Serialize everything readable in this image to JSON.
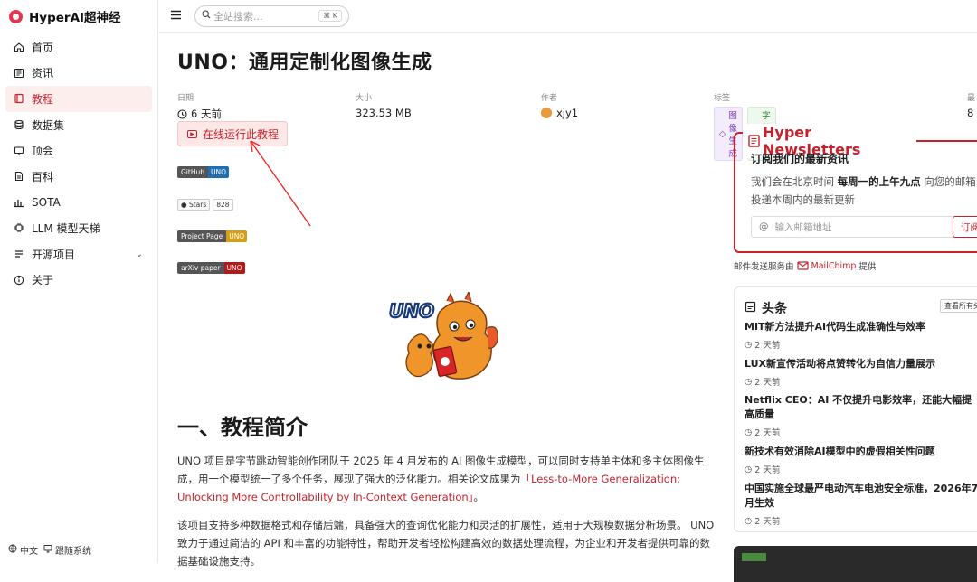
{
  "app": {
    "name": "HyperAI超神经"
  },
  "sidebar": {
    "items": [
      {
        "label": "首页",
        "icon": "home-icon"
      },
      {
        "label": "资讯",
        "icon": "news-icon"
      },
      {
        "label": "教程",
        "icon": "book-icon",
        "active": true
      },
      {
        "label": "数据集",
        "icon": "database-icon"
      },
      {
        "label": "顶会",
        "icon": "conference-icon"
      },
      {
        "label": "百科",
        "icon": "wiki-icon"
      },
      {
        "label": "SOTA",
        "icon": "chart-icon"
      },
      {
        "label": "LLM 模型天梯",
        "icon": "cpu-icon"
      },
      {
        "label": "开源项目",
        "icon": "list-icon",
        "expandable": true
      },
      {
        "label": "关于",
        "icon": "info-icon"
      }
    ],
    "footer": {
      "language": "中文",
      "theme": "跟随系统"
    }
  },
  "topbar": {
    "search_placeholder": "全站搜索...",
    "shortcut": "⌘ K"
  },
  "article": {
    "title": "UNO：通用定制化图像生成",
    "meta": {
      "date_label": "日期",
      "date_value": "6 天前",
      "size_label": "大小",
      "size_value": "323.53 MB",
      "author_label": "作者",
      "author_value": "xjy1",
      "tags_label": "标签",
      "tags": [
        "图像生成",
        "字节跳动"
      ],
      "extra_label": "最",
      "extra_value": "8"
    },
    "run_button": "在线运行此教程",
    "badges": [
      {
        "left": "GitHub",
        "right": "UNO",
        "color": "#1f6fb2"
      },
      {
        "left": "Stars",
        "right": "828"
      },
      {
        "left": "Project Page",
        "right": "UNO",
        "color": "#d4a017"
      },
      {
        "left": "arXiv paper",
        "right": "UNO",
        "color": "#b31b1b"
      }
    ],
    "hero_logo_text": "UNO",
    "section_title": "一、教程简介",
    "para1_text": "UNO 项目是字节跳动智能创作团队于 2025 年 4 月发布的 AI 图像生成模型，可以同时支持单主体和多主体图像生成，用一个模型统一了多个任务，展现了强大的泛化能力。相关论文成果为",
    "para1_link": "「Less-to-More Generalization: Unlocking More Controllability by In-Context Generation」",
    "para1_end": "。",
    "para2_text": "该项目支持多种数据格式和存储后端，具备强大的查询优化能力和灵活的扩展性，适用于大规模数据分析场景。 UNO 致力于通过简洁的 API 和丰富的功能特性，帮助开发者轻松构建高效的数据处理流程，为企业和开发者提供可靠的数据基础设施支持。"
  },
  "newsletter": {
    "title": "Hyper Newsletters",
    "heading": "订阅我们的最新资讯",
    "desc_pre": "我们会在北京时间 ",
    "desc_bold": "每周一的上午九点",
    "desc_post": " 向您的邮箱投递本周内的最新更新",
    "email_placeholder": "输入邮箱地址",
    "subscribe": "订阅",
    "service_pre": "邮件发送服务由",
    "service_name": "MailChimp",
    "service_post": "提供"
  },
  "headlines": {
    "title": "头条",
    "see_all": "查看所有头条",
    "items": [
      {
        "title": "MIT新方法提升AI代码生成准确性与效率",
        "time": "2 天前"
      },
      {
        "title": "LUX新宣传活动将点赞转化为自信力量展示",
        "time": "2 天前"
      },
      {
        "title": "Netflix CEO：AI 不仅提升电影效率，还能大幅提高质量",
        "time": "2 天前"
      },
      {
        "title": "新技术有效消除AI模型中的虚假相关性问题",
        "time": "2 天前"
      },
      {
        "title": "中国实施全球最严电动汽车电池安全标准，2026年7月生效",
        "time": "2 天前"
      }
    ]
  },
  "colors": {
    "accent": "#c3232b",
    "active_bg": "#fdeeee"
  }
}
